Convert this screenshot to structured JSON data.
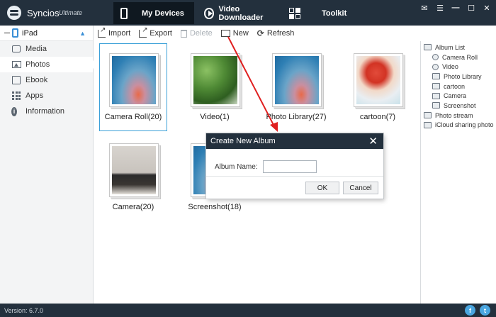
{
  "app": {
    "name": "Syncios",
    "edition": "Ultimate"
  },
  "nav": {
    "tabs": [
      {
        "label": "My Devices"
      },
      {
        "label": "Video Downloader"
      },
      {
        "label": "Toolkit"
      }
    ]
  },
  "window_controls": {
    "message": "✉",
    "menu": "☰",
    "minimize": "—",
    "maximize": "☐",
    "close": "✕"
  },
  "sidebar": {
    "device": "iPad",
    "items": [
      {
        "label": "Media"
      },
      {
        "label": "Photos"
      },
      {
        "label": "Ebook"
      },
      {
        "label": "Apps"
      },
      {
        "label": "Information"
      }
    ]
  },
  "toolbar": {
    "import": "Import",
    "export": "Export",
    "delete": "Delete",
    "new": "New",
    "refresh": "Refresh"
  },
  "albums": [
    {
      "label": "Camera Roll(20)"
    },
    {
      "label": "Video(1)"
    },
    {
      "label": "Photo Library(27)"
    },
    {
      "label": "cartoon(7)"
    },
    {
      "label": "Camera(20)"
    },
    {
      "label": "Screenshot(18)"
    }
  ],
  "right_panel": {
    "album_list": "Album List",
    "albums": [
      "Camera Roll",
      "Video",
      "Photo Library",
      "cartoon",
      "Camera",
      "Screenshot"
    ],
    "photo_stream": "Photo stream",
    "icloud": "iCloud sharing photo"
  },
  "dialog": {
    "title": "Create New Album",
    "close": "✕",
    "field_label": "Album Name:",
    "field_value": "",
    "ok": "OK",
    "cancel": "Cancel"
  },
  "status": {
    "version": "Version: 6.7.0",
    "facebook": "f",
    "twitter": "t"
  },
  "colors": {
    "titlebar": "#23303d",
    "accent": "#3aa0d8",
    "arrow": "#e02020"
  }
}
